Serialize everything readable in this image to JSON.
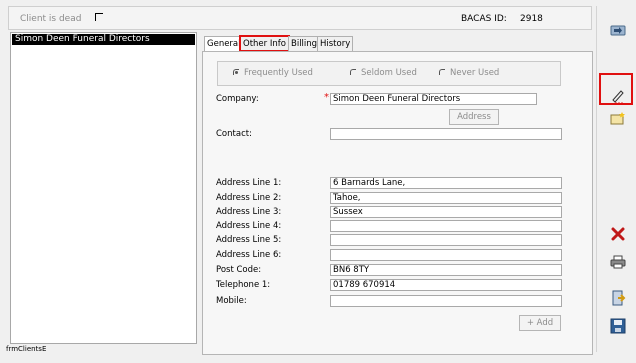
{
  "top": {
    "client_dead_label": "Client is dead",
    "bacas_label": "BACAS ID:",
    "bacas_value": "2918"
  },
  "client_list": {
    "items": [
      "Simon Deen Funeral Directors"
    ]
  },
  "form_name": "frmClientsE",
  "tabs": [
    {
      "label": "General",
      "active": true
    },
    {
      "label": "Other Info",
      "highlighted": true
    },
    {
      "label": "Billing"
    },
    {
      "label": "History"
    }
  ],
  "usage": {
    "options": [
      "Frequently Used",
      "Seldom Used",
      "Never Used"
    ],
    "selected": "Frequently Used"
  },
  "form": {
    "company_label": "Company:",
    "company_value": "Simon Deen Funeral Directors",
    "required_marker": "*",
    "address_button": "Address",
    "contact_label": "Contact:",
    "contact_value": "",
    "address1_label": "Address Line 1:",
    "address1_value": "6 Barnards Lane,",
    "address2_label": "Address Line 2:",
    "address2_value": "Tahoe,",
    "address3_label": "Address Line 3:",
    "address3_value": "Sussex",
    "address4_label": "Address Line 4:",
    "address4_value": "",
    "address5_label": "Address Line 5:",
    "address5_value": "",
    "address6_label": "Address Line 6:",
    "address6_value": "",
    "postcode_label": "Post Code:",
    "postcode_value": "BN6 8TY",
    "telephone_label": "Telephone 1:",
    "telephone_value": "01789 670914",
    "mobile_label": "Mobile:",
    "mobile_value": "",
    "add_button": "+ Add"
  },
  "toolbar": {
    "icons": [
      "export-icon",
      "edit-icon",
      "new-folder-icon",
      "delete-icon",
      "print-icon",
      "exit-icon",
      "save-icon"
    ],
    "highlighted": "edit-icon"
  },
  "colors": {
    "highlight": "#e01010",
    "selection": "#000000",
    "panel_bg": "#f7f7f7",
    "disabled_text": "#8c8c8c"
  }
}
